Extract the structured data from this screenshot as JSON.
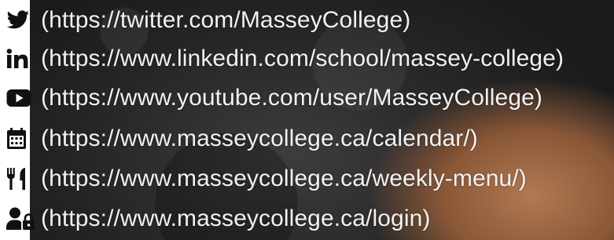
{
  "colors": {
    "icon": "#111111",
    "text": "#f2f2f2"
  },
  "links": [
    {
      "icon": "twitter-icon",
      "url": "(https://twitter.com/MasseyCollege)"
    },
    {
      "icon": "linkedin-icon",
      "url": "(https://www.linkedin.com/school/massey-college)"
    },
    {
      "icon": "youtube-icon",
      "url": "(https://www.youtube.com/user/MasseyCollege)"
    },
    {
      "icon": "calendar-icon",
      "url": "(https://www.masseycollege.ca/calendar/)"
    },
    {
      "icon": "utensils-icon",
      "url": "(https://www.masseycollege.ca/weekly-menu/)"
    },
    {
      "icon": "user-lock-icon",
      "url": "(https://www.masseycollege.ca/login)"
    }
  ]
}
